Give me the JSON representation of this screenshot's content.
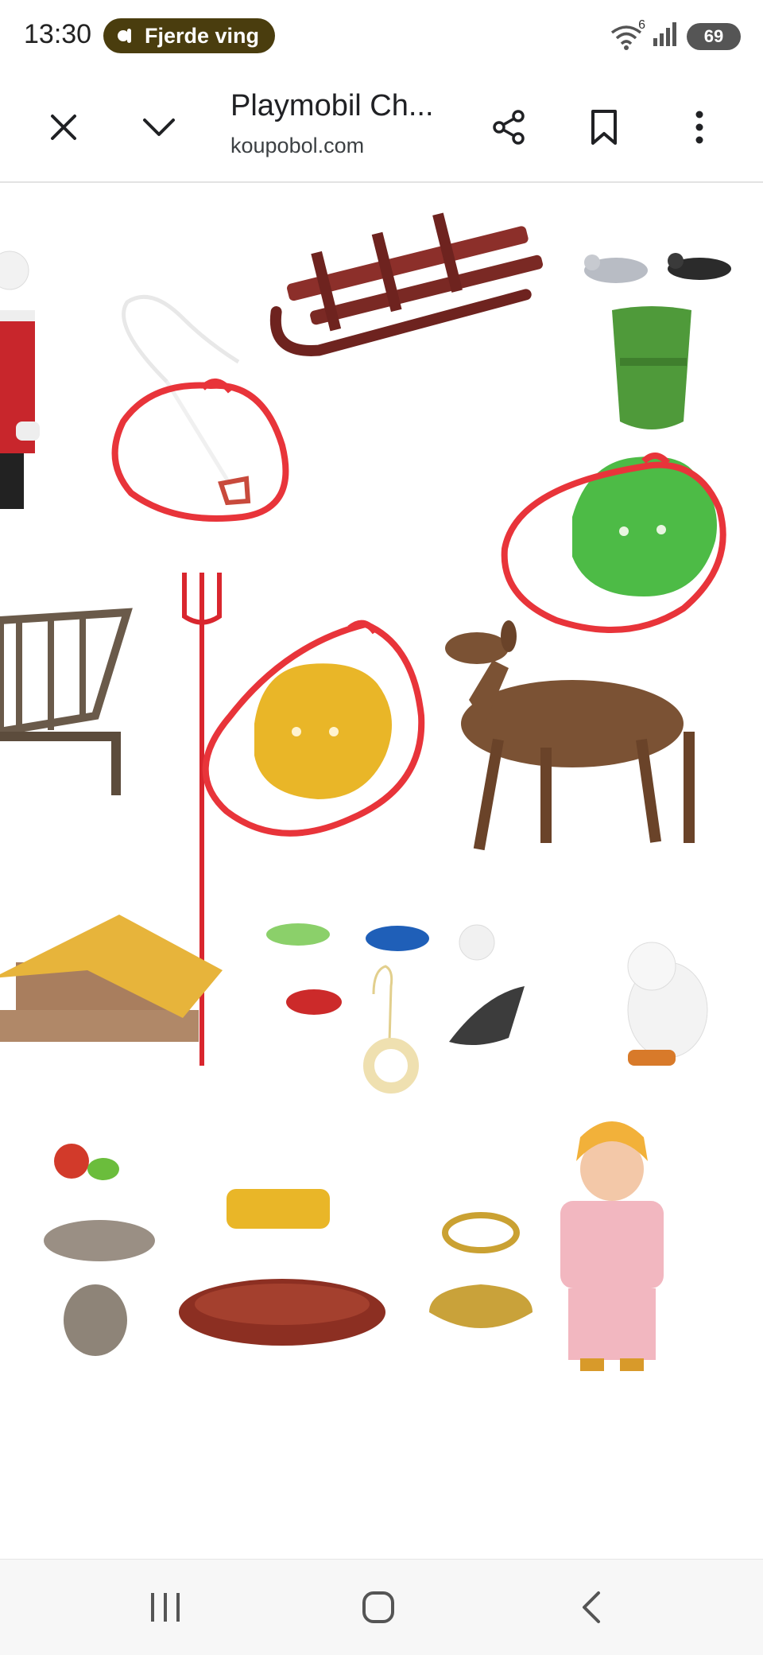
{
  "status": {
    "time": "13:30",
    "notification_pill": "Fjerde ving",
    "wifi_badge": "6",
    "battery": "69"
  },
  "toolbar": {
    "title": "Playmobil Ch...",
    "url": "koupobol.com",
    "icons": [
      "close-icon",
      "chevron-down-icon",
      "share-icon",
      "bookmark-icon",
      "more-vert-icon"
    ]
  },
  "image": {
    "annotation_color": "#e8343a",
    "circled_items": [
      "hay-lasso",
      "green-hay-bundle",
      "yellow-hay-bundle"
    ]
  },
  "navbar": {
    "icons": [
      "recent-apps-icon",
      "home-icon",
      "back-icon"
    ]
  }
}
